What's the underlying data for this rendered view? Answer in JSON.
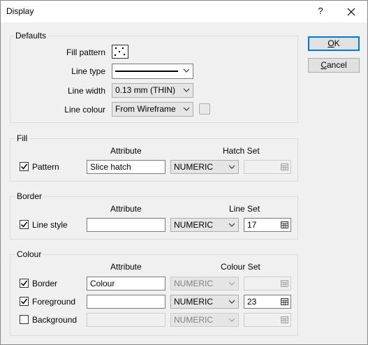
{
  "window": {
    "title": "Display",
    "help": "?"
  },
  "buttons": {
    "ok": "OK",
    "ok_mnemonic": "O",
    "ok_rest": "K",
    "cancel_mnemonic": "C",
    "cancel_rest": "ancel"
  },
  "defaults": {
    "group_label": "Defaults",
    "fill_pattern_label": "Fill pattern",
    "line_type_label": "Line type",
    "line_width_label": "Line width",
    "line_width_value": "0.13 mm (THIN)",
    "line_colour_label": "Line colour",
    "line_colour_value": "From Wireframe"
  },
  "fill": {
    "group_label": "Fill",
    "attribute_header": "Attribute",
    "set_header": "Hatch Set",
    "row": {
      "label": "Pattern",
      "checked": true,
      "attribute": "Slice hatch",
      "type": "NUMERIC",
      "set_value": ""
    }
  },
  "border": {
    "group_label": "Border",
    "attribute_header": "Attribute",
    "set_header": "Line Set",
    "row": {
      "label": "Line style",
      "checked": true,
      "attribute": "",
      "type": "NUMERIC",
      "set_value": "17"
    }
  },
  "colour": {
    "group_label": "Colour",
    "attribute_header": "Attribute",
    "set_header": "Colour Set",
    "rows": [
      {
        "label": "Border",
        "checked": true,
        "attribute": "Colour",
        "type": "NUMERIC",
        "set_value": "",
        "enabled": false
      },
      {
        "label": "Foreground",
        "checked": true,
        "attribute": "",
        "type": "NUMERIC",
        "set_value": "23",
        "enabled": true
      },
      {
        "label": "Background",
        "checked": false,
        "attribute": "",
        "type": "NUMERIC",
        "set_value": "",
        "enabled": false
      }
    ]
  }
}
